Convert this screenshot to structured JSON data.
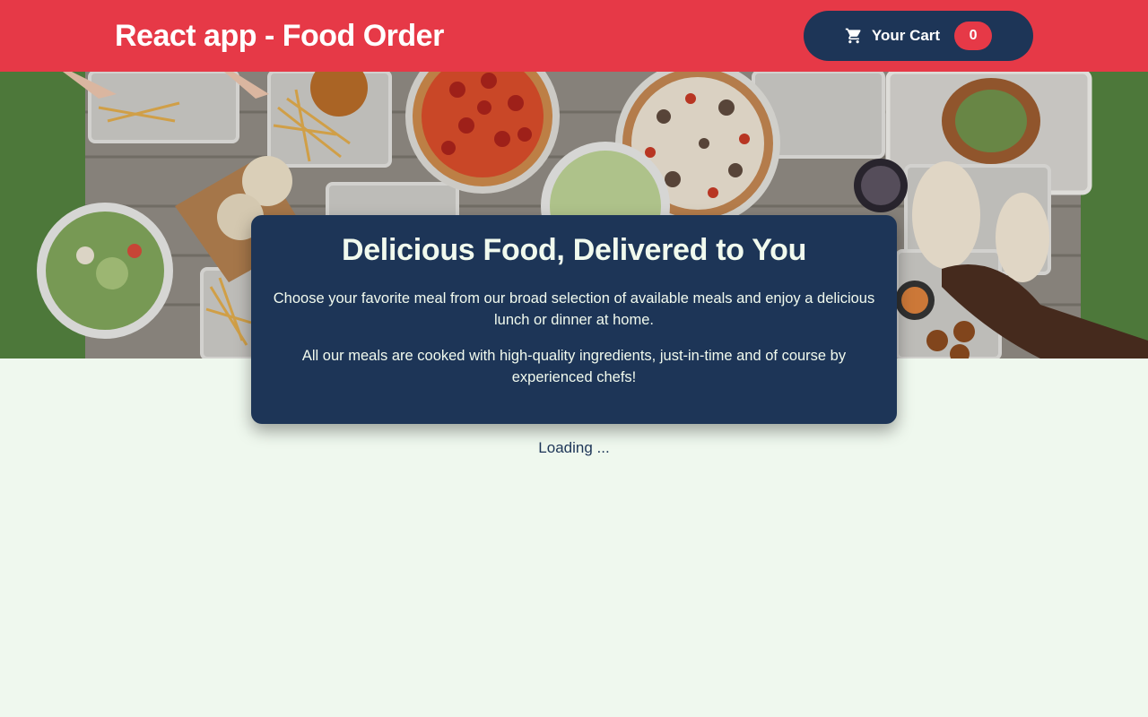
{
  "header": {
    "title": "React app - Food Order",
    "cart_label": "Your Cart",
    "cart_count": "0",
    "cart_icon": "cart-icon"
  },
  "hero": {
    "image": "food-table-photo"
  },
  "summary": {
    "heading": "Delicious Food, Delivered to You",
    "paragraph_1": "Choose your favorite meal from our broad selection of available meals and enjoy a delicious lunch or dinner at home.",
    "paragraph_2": "All our meals are cooked with high-quality ingredients, just-in-time and of course by experienced chefs!"
  },
  "status": {
    "loading_text": "Loading ..."
  },
  "colors": {
    "header_bg": "#e63947",
    "accent_dark": "#1d3557",
    "page_bg": "#eff8ee",
    "summary_text": "#f1faee"
  }
}
